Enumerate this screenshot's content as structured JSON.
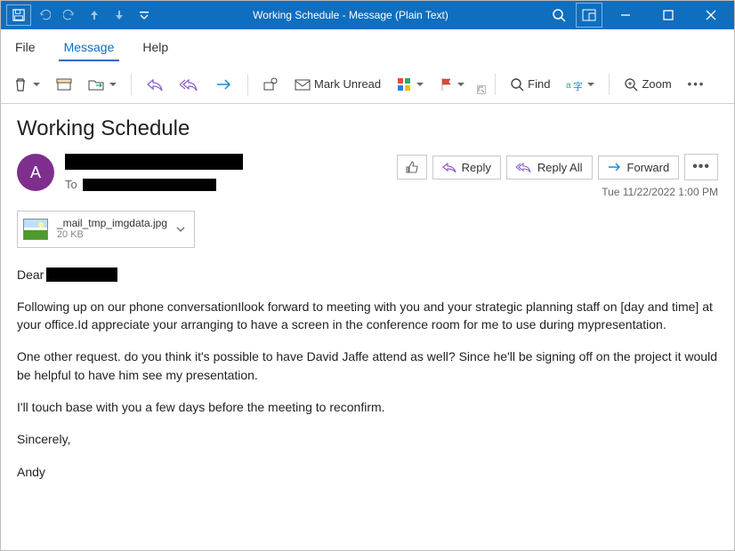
{
  "titlebar": {
    "title": "Working Schedule  -  Message (Plain Text)"
  },
  "menu": {
    "file": "File",
    "message": "Message",
    "help": "Help"
  },
  "ribbon": {
    "mark_unread": "Mark Unread",
    "find": "Find",
    "zoom": "Zoom"
  },
  "email": {
    "subject": "Working Schedule",
    "avatar_initial": "A",
    "to_label": "To",
    "timestamp": "Tue 11/22/2022 1:00 PM",
    "actions": {
      "reply": "Reply",
      "reply_all": "Reply All",
      "forward": "Forward"
    },
    "attachment": {
      "name": "_mail_tmp_imgdata.jpg",
      "size": "20 KB"
    },
    "body": {
      "dear": "Dear",
      "p1": "Following up on our phone conversationIlook forward to meeting with you and your strategic planning staff on [day and time] at your office.Id appreciate your arranging to have a screen in the conference room for me to use during mypresentation.",
      "p2": "One other request. do you think it's possible to have David Jaffe attend as well? Since he'll be signing off on the project it would be helpful to have him see my presentation.",
      "p3": "I'll touch base with you a few days before the meeting to reconfirm.",
      "closing": "Sincerely,",
      "signature": "Andy"
    }
  }
}
